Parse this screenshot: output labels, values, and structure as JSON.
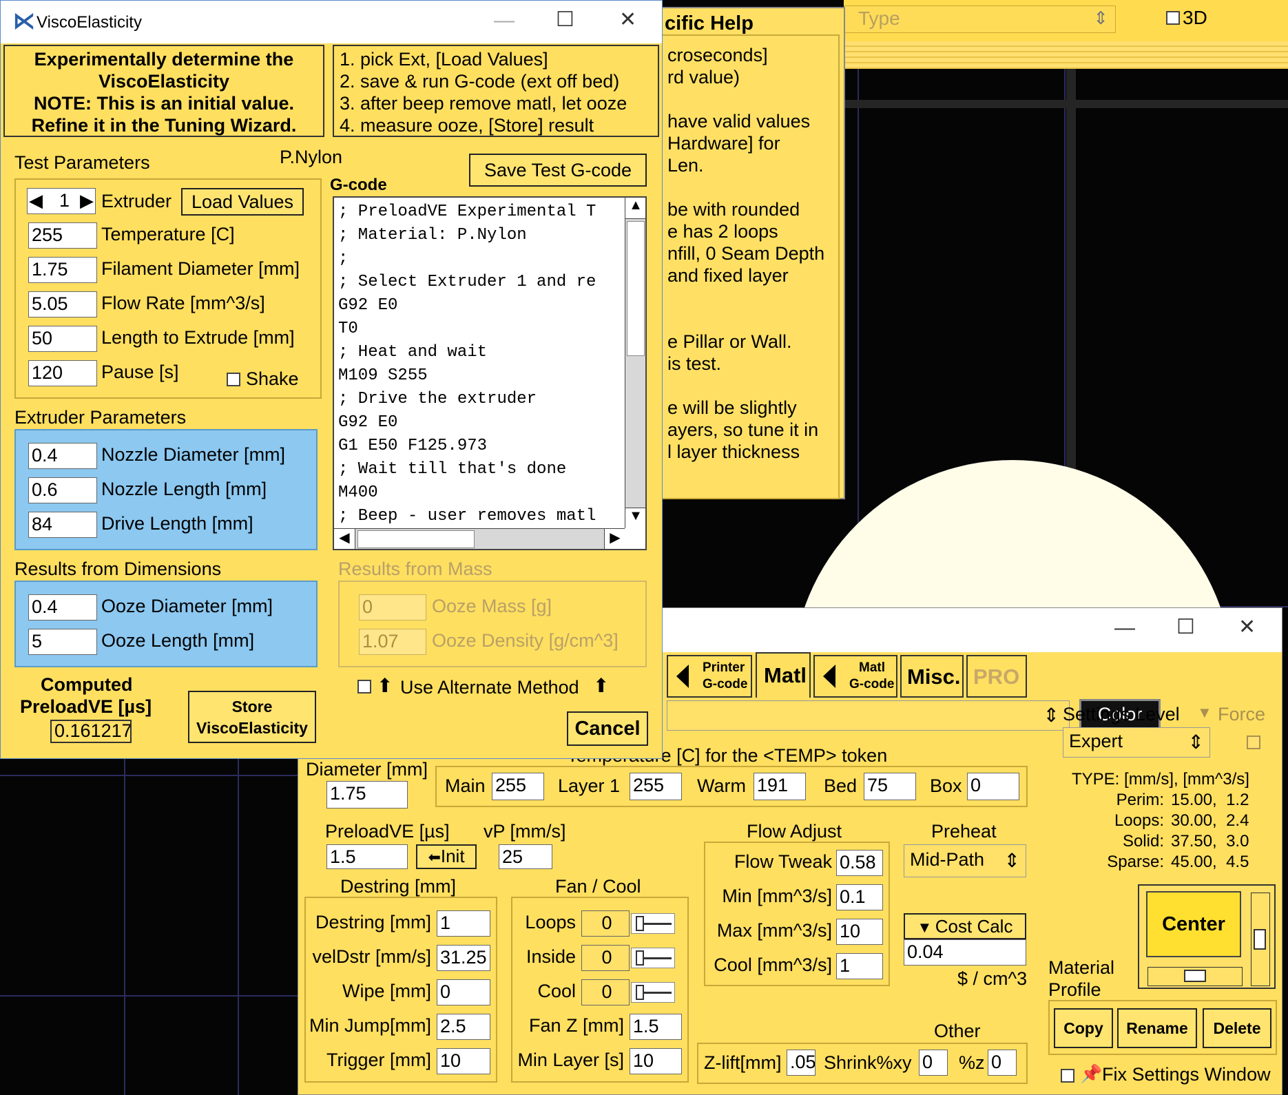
{
  "background_window": {
    "type_field": "Type",
    "checkbox_3d_label": "3D"
  },
  "specific_help": {
    "title": "cific Help",
    "lines": [
      "croseconds]",
      "rd value)",
      "",
      "have valid values",
      "Hardware] for",
      "Len.",
      "",
      "be with rounded",
      "e has 2 loops",
      "nfill, 0 Seam Depth",
      "and fixed layer",
      "",
      "",
      "e Pillar or Wall.",
      "is test.",
      "",
      "e will be slightly",
      "ayers, so tune it in",
      "l layer thickness"
    ]
  },
  "visco": {
    "title": "ViscoElasticity",
    "header_box": [
      "Experimentally determine the",
      "ViscoElasticity",
      "NOTE: This is an initial value.",
      "Refine it in the Tuning Wizard."
    ],
    "steps": [
      "1. pick Ext, [Load Values]",
      "2. save & run G-code (ext off bed)",
      "3. after beep remove matl, let ooze",
      "4. measure ooze, [Store] result"
    ],
    "test_params_label": "Test Parameters",
    "material_name": "P.Nylon",
    "save_gcode_label": "Save Test G-code",
    "gcode_label": "G-code",
    "extruder_num": "1",
    "extruder_label": "Extruder",
    "load_values_label": "Load Values",
    "temperature_value": "255",
    "temperature_label": "Temperature [C]",
    "filament_value": "1.75",
    "filament_label": "Filament Diameter [mm]",
    "flow_value": "5.05",
    "flow_label": "Flow Rate [mm^3/s]",
    "length_value": "50",
    "length_label": "Length to Extrude [mm]",
    "pause_value": "120",
    "pause_label": "Pause [s]",
    "shake_label": "Shake",
    "gcode_lines": [
      "; PreloadVE Experimental T",
      "; Material: P.Nylon",
      ";",
      "; Select Extruder 1 and re",
      "G92 E0",
      "T0",
      "; Heat and wait",
      "M109 S255",
      "; Drive the extruder",
      "G92 E0",
      "G1 E50 F125.973",
      "; Wait till that's done",
      "M400",
      "; Beep - user removes matl"
    ],
    "extruder_params_label": "Extruder Parameters",
    "nozzle_diam_value": "0.4",
    "nozzle_diam_label": "Nozzle Diameter [mm]",
    "nozzle_len_value": "0.6",
    "nozzle_len_label": "Nozzle Length [mm]",
    "drive_len_value": "84",
    "drive_len_label": "Drive Length [mm]",
    "results_dim_label": "Results from Dimensions",
    "ooze_diam_value": "0.4",
    "ooze_diam_label": "Ooze Diameter [mm]",
    "ooze_len_value": "5",
    "ooze_len_label": "Ooze Length [mm]",
    "results_mass_label": "Results from Mass",
    "ooze_mass_value": "0",
    "ooze_mass_label": "Ooze Mass [g]",
    "ooze_density_value": "1.07",
    "ooze_density_label": "Ooze Density [g/cm^3]",
    "computed_label_1": "Computed",
    "computed_label_2": "PreloadVE [µs]",
    "computed_value": "0.161217",
    "store_label_1": "Store",
    "store_label_2": "ViscoElasticity",
    "alt_method_label": "Use Alternate Method",
    "cancel_label": "Cancel"
  },
  "settings": {
    "tabs": {
      "printer_gcode_1": "Printer",
      "printer_gcode_2": "G-code",
      "matl": "Matl",
      "matl_gcode_1": "Matl",
      "matl_gcode_2": "G-code",
      "misc": "Misc.",
      "pro": "PRO"
    },
    "color_label": "Color",
    "temp_token_label": "Temperature [C] for the <TEMP> token",
    "diameter_label": "Diameter [mm]",
    "diameter_value": "1.75",
    "temp_main_label": "Main",
    "temp_main_value": "255",
    "temp_layer1_label": "Layer 1",
    "temp_layer1_value": "255",
    "temp_warm_label": "Warm",
    "temp_warm_value": "191",
    "temp_bed_label": "Bed",
    "temp_bed_value": "75",
    "temp_box_label": "Box",
    "temp_box_value": "0",
    "preload_label": "PreloadVE [µs]",
    "preload_value": "1.5",
    "init_label": "Init",
    "vp_label": "vP [mm/s]",
    "vp_value": "25",
    "destring_group_label": "Destring [mm]",
    "destring_label": "Destring [mm]",
    "destring_value": "1",
    "veldstr_label": "velDstr [mm/s]",
    "veldstr_value": "31.25",
    "wipe_label": "Wipe [mm]",
    "wipe_value": "0",
    "minjump_label": "Min Jump[mm]",
    "minjump_value": "2.5",
    "trigger_label": "Trigger [mm]",
    "trigger_value": "10",
    "fan_group_label": "Fan / Cool",
    "loops_label": "Loops",
    "loops_value": "0",
    "inside_label": "Inside",
    "inside_value": "0",
    "cool_label": "Cool",
    "cool_value": "0",
    "fanz_label": "Fan Z [mm]",
    "fanz_value": "1.5",
    "minlayer_label": "Min Layer [s]",
    "minlayer_value": "10",
    "flow_adjust_label": "Flow Adjust",
    "flowtweak_label": "Flow Tweak",
    "flowtweak_value": "0.58",
    "min_flow_label": "Min [mm^3/s]",
    "min_flow_value": "0.1",
    "max_flow_label": "Max [mm^3/s]",
    "max_flow_value": "10",
    "cool_flow_label": "Cool [mm^3/s]",
    "cool_flow_value": "1",
    "preheat_label": "Preheat",
    "preheat_value": "Mid-Path",
    "cost_calc_label": "Cost Calc",
    "cost_value": "0.04",
    "cost_unit": "$ / cm^3",
    "other_label": "Other",
    "zlift_label": "Z-lift[mm]",
    "zlift_value": ".05",
    "shrink_label": "Shrink%xy",
    "shrink_value": "0",
    "pz_label": "%z",
    "pz_value": "0",
    "settings_level_label": "Settings Level",
    "force_label": "Force",
    "level_value": "Expert",
    "type_header": "TYPE: [mm/s], [mm^3/s]",
    "type_rows": [
      {
        "label": "Perim:",
        "value": "15.00,  1.2"
      },
      {
        "label": "Loops:",
        "value": "30.00,  2.4"
      },
      {
        "label": "Solid:",
        "value": "37.50,  3.0"
      },
      {
        "label": "Sparse:",
        "value": "45.00,  4.5"
      }
    ],
    "center_label": "Center",
    "material_profile_1": "Material",
    "material_profile_2": "Profile",
    "copy_label": "Copy",
    "rename_label": "Rename",
    "delete_label": "Delete",
    "fix_settings_label": "Fix Settings Window"
  },
  "colors": {
    "panel_yellow": "#FFDF60",
    "blue_group": "#8CC8F0",
    "background": "#000000",
    "cream_shape": "#FFFDE8"
  }
}
